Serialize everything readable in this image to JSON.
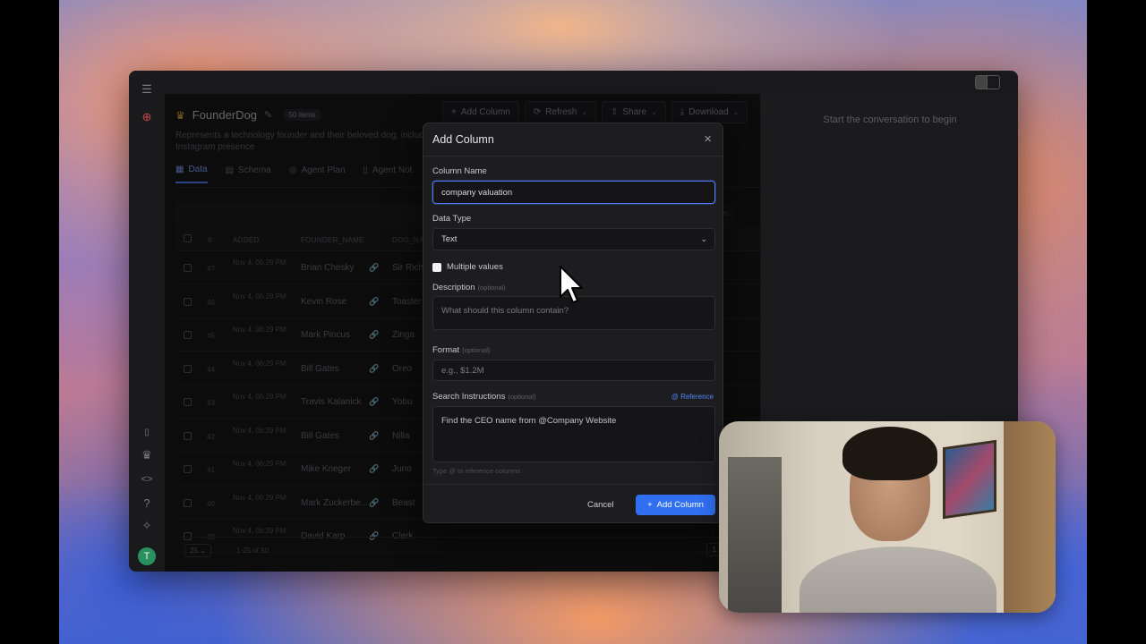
{
  "app": {
    "title": "FounderDog",
    "item_count": "50 items",
    "description": "Represents a technology founder and their beloved dog, including Instagram presence",
    "toolbar": [
      {
        "label": "Add Column",
        "icon": "plus-icon"
      },
      {
        "label": "Refresh",
        "icon": "refresh-icon"
      },
      {
        "label": "Share",
        "icon": "share-icon"
      },
      {
        "label": "Download",
        "icon": "download-icon"
      }
    ],
    "tabs": [
      {
        "label": "Data",
        "icon": "table-icon",
        "active": true
      },
      {
        "label": "Schema",
        "icon": "schema-icon"
      },
      {
        "label": "Agent Plan",
        "icon": "agent-icon"
      },
      {
        "label": "Agent Not",
        "icon": "note-icon"
      }
    ],
    "row_ids_label": "ow IDs"
  },
  "table": {
    "columns": [
      "#",
      "ADDED",
      "FOUNDER_NAME",
      "DOG_NA"
    ],
    "rows": [
      {
        "num": "47",
        "added": "Nov 4, 06:29 PM",
        "founder": "Brian Chesky",
        "dog": "Sir Richa"
      },
      {
        "num": "46",
        "added": "Nov 4, 06:29 PM",
        "founder": "Kevin Rose",
        "dog": "Toaster"
      },
      {
        "num": "45",
        "added": "Nov 4, 06:29 PM",
        "founder": "Mark Pincus",
        "dog": "Zinga"
      },
      {
        "num": "44",
        "added": "Nov 4, 06:29 PM",
        "founder": "Bill Gates",
        "dog": "Oreo"
      },
      {
        "num": "43",
        "added": "Nov 4, 06:29 PM",
        "founder": "Travis Kalanick",
        "dog": "Yobu"
      },
      {
        "num": "42",
        "added": "Nov 4, 06:29 PM",
        "founder": "Bill Gates",
        "dog": "Nilla"
      },
      {
        "num": "41",
        "added": "Nov 4, 06:29 PM",
        "founder": "Mike Krieger",
        "dog": "Juno"
      },
      {
        "num": "40",
        "added": "Nov 4, 06:29 PM",
        "founder": "Mark Zuckerbe...",
        "dog": "Beast"
      },
      {
        "num": "39",
        "added": "Nov 4, 06:29 PM",
        "founder": "David Karp",
        "dog": "Clark"
      }
    ],
    "page_size": "25",
    "range_label": "1-25 of 50",
    "page": "1"
  },
  "chat": {
    "hint": "Start the conversation to begin"
  },
  "modal": {
    "title": "Add Column",
    "column_name_label": "Column Name",
    "column_name_value": "company valuation",
    "data_type_label": "Data Type",
    "data_type_value": "Text",
    "multiple_values_label": "Multiple values",
    "description_label": "Description",
    "optional": "(optional)",
    "description_placeholder": "What should this column contain?",
    "format_label": "Format",
    "format_placeholder": "e.g., $1.2M",
    "search_label": "Search Instructions",
    "reference_label": "@ Reference",
    "search_value": "Find the CEO name from @Company Website",
    "hint": "Type @ to reference columns",
    "cancel_label": "Cancel",
    "add_label": "Add Column"
  },
  "colors": {
    "accent": "#2f6ff0",
    "background": "#171719",
    "crown": "#d7a83a",
    "avatar": "#2a8f5e"
  },
  "sidebar": {
    "avatar_initial": "T"
  }
}
